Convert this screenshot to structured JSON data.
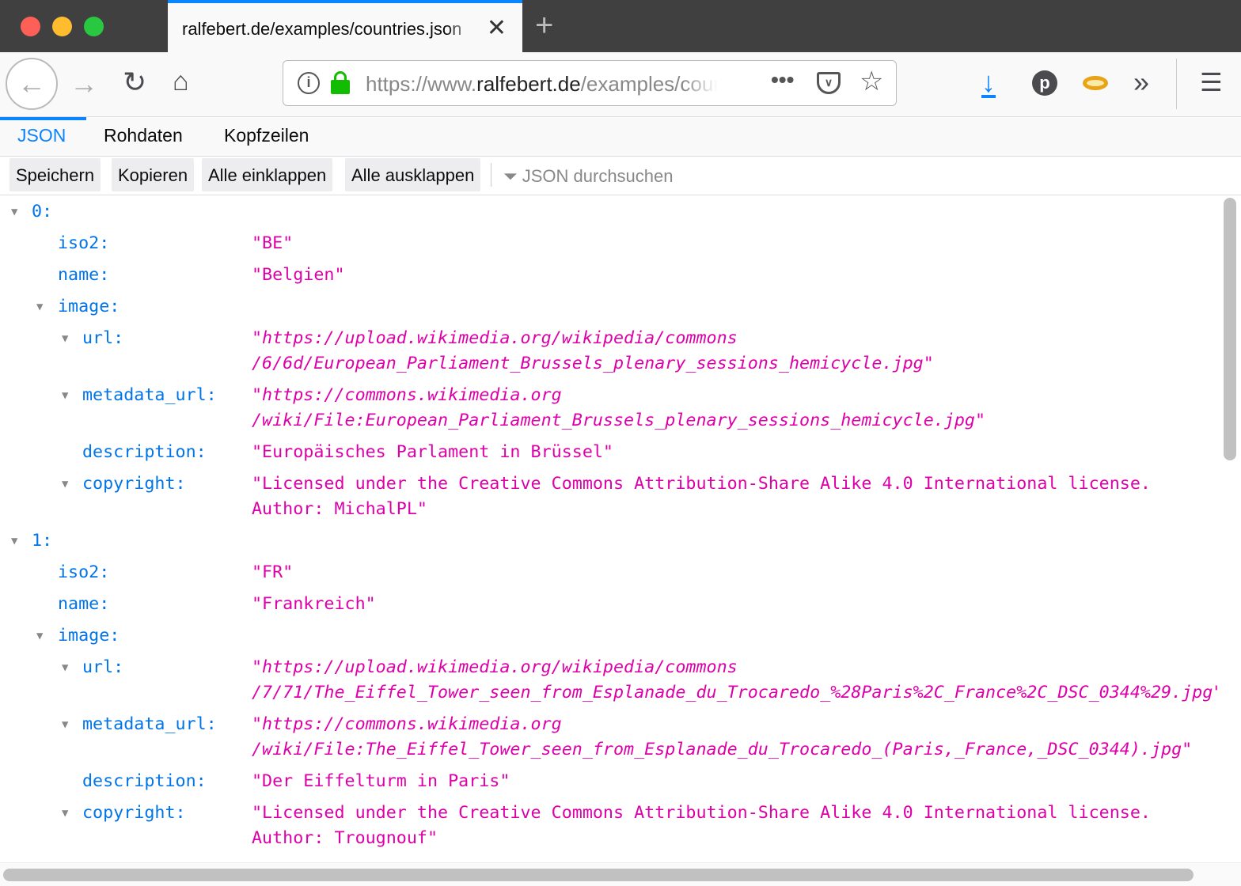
{
  "window": {
    "colors": {
      "close": "#fe5f57",
      "minimize": "#febc2e",
      "zoom": "#28c840"
    }
  },
  "tab": {
    "title": "ralfebert.de/examples/countries.json"
  },
  "url": {
    "prefix": "https://www.",
    "domain": "ralfebert.de",
    "path": "/examples/countries.json"
  },
  "viewer": {
    "tabs": [
      "JSON",
      "Rohdaten",
      "Kopfzeilen"
    ],
    "buttons": [
      "Speichern",
      "Kopieren",
      "Alle einklappen",
      "Alle ausklappen"
    ],
    "filter_placeholder": "JSON durchsuchen"
  },
  "rows": [
    {
      "key": "0:",
      "level": 0,
      "toggle": true,
      "lines": []
    },
    {
      "key": "iso2:",
      "level": 1,
      "lines": [
        "\"BE\""
      ]
    },
    {
      "key": "name:",
      "level": 1,
      "lines": [
        "\"Belgien\""
      ]
    },
    {
      "key": "image:",
      "level": 1,
      "toggle": true,
      "lines": []
    },
    {
      "key": "url:",
      "level": 2,
      "toggle": true,
      "italic": true,
      "lines": [
        "\"https://upload.wikimedia.org/wikipedia/commons",
        "/6/6d/European_Parliament_Brussels_plenary_sessions_hemicycle.jpg\""
      ]
    },
    {
      "key": "metadata_url:",
      "level": 2,
      "toggle": true,
      "italic": true,
      "lines": [
        "\"https://commons.wikimedia.org",
        "/wiki/File:European_Parliament_Brussels_plenary_sessions_hemicycle.jpg\""
      ]
    },
    {
      "key": "description:",
      "level": 2,
      "lines": [
        "\"Europäisches Parlament in Brüssel\""
      ]
    },
    {
      "key": "copyright:",
      "level": 2,
      "toggle": true,
      "lines": [
        "\"Licensed under the Creative Commons Attribution-Share Alike 4.0 International license.",
        "Author: MichalPL\""
      ]
    },
    {
      "key": "1:",
      "level": 0,
      "toggle": true,
      "lines": []
    },
    {
      "key": "iso2:",
      "level": 1,
      "lines": [
        "\"FR\""
      ]
    },
    {
      "key": "name:",
      "level": 1,
      "lines": [
        "\"Frankreich\""
      ]
    },
    {
      "key": "image:",
      "level": 1,
      "toggle": true,
      "lines": []
    },
    {
      "key": "url:",
      "level": 2,
      "toggle": true,
      "italic": true,
      "lines": [
        "\"https://upload.wikimedia.org/wikipedia/commons",
        "/7/71/The_Eiffel_Tower_seen_from_Esplanade_du_Trocaredo_%28Paris%2C_France%2C_DSC_0344%29.jpg\""
      ]
    },
    {
      "key": "metadata_url:",
      "level": 2,
      "toggle": true,
      "italic": true,
      "lines": [
        "\"https://commons.wikimedia.org",
        "/wiki/File:The_Eiffel_Tower_seen_from_Esplanade_du_Trocaredo_(Paris,_France,_DSC_0344).jpg\""
      ]
    },
    {
      "key": "description:",
      "level": 2,
      "lines": [
        "\"Der Eiffelturm in Paris\""
      ]
    },
    {
      "key": "copyright:",
      "level": 2,
      "toggle": true,
      "lines": [
        "\"Licensed under the Creative Commons Attribution-Share Alike 4.0 International license.",
        "Author: Trougnouf\""
      ]
    }
  ]
}
